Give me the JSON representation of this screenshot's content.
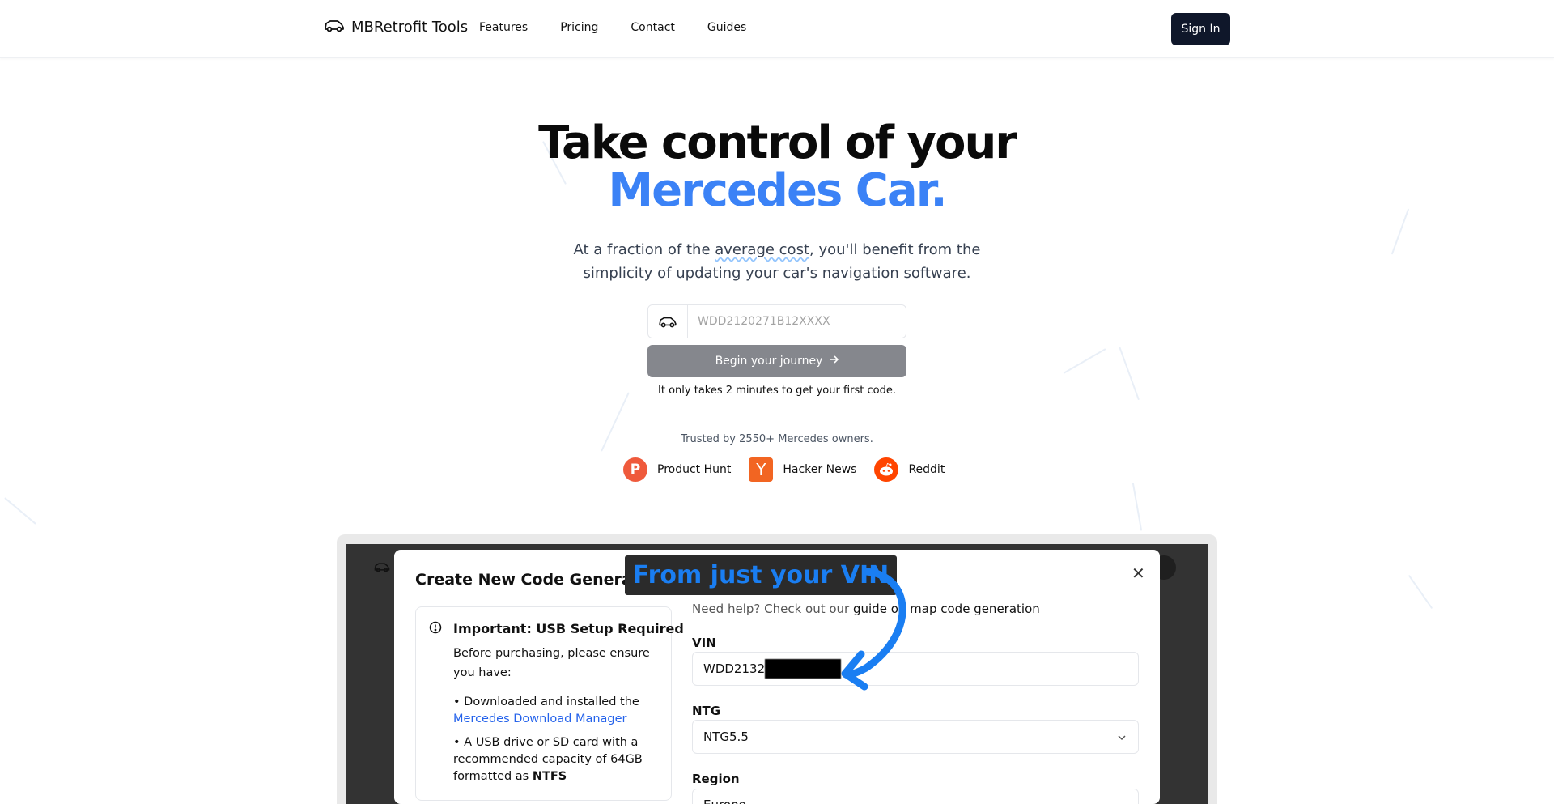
{
  "header": {
    "brand": "MBRetrofit Tools",
    "nav": [
      "Features",
      "Pricing",
      "Contact",
      "Guides"
    ],
    "signin": "Sign In"
  },
  "hero": {
    "title_line1": "Take control of your",
    "title_line2": "Mercedes Car.",
    "sub_part1": "At a fraction of the ",
    "sub_squiggle": "average cost",
    "sub_part2": ", you'll benefit from the",
    "sub_line2": "simplicity of updating your car's navigation software.",
    "vin_placeholder": "WDD2120271B12XXXX",
    "cta": "Begin your journey",
    "note": "It only takes 2 minutes to get your first code.",
    "trusted": "Trusted by 2550+ Mercedes owners.",
    "socials": [
      "Product Hunt",
      "Hacker News",
      "Reddit"
    ]
  },
  "preview": {
    "modal_title": "Create New Code Generation",
    "usb_title": "Important: USB Setup Required",
    "usb_text": "Before purchasing, please ensure you have:",
    "usb_item1_prefix": "Downloaded and installed the",
    "usb_item1_link": "Mercedes Download Manager",
    "usb_item2_prefix": "A USB drive or SD card with a recommended capacity of 64GB formatted as ",
    "usb_item2_bold": "NTFS",
    "help_prefix": "Need help? Check out our ",
    "help_link": "guide on map code generation",
    "vin_label": "VIN",
    "vin_value": "WDD2132",
    "ntg_label": "NTG",
    "ntg_value": "NTG5.5",
    "region_label": "Region",
    "region_value": "Europe",
    "overlay": "From just your VIN"
  },
  "colors": {
    "accent": "#3b82f6",
    "signin_bg": "#0f172a",
    "cta_bg": "#85878d"
  }
}
